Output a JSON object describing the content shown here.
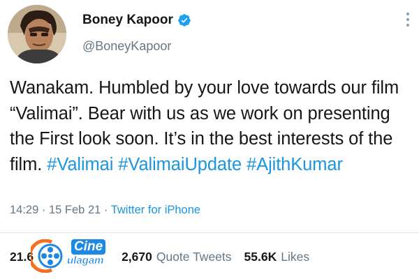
{
  "user": {
    "display_name": "Boney Kapoor",
    "handle": "@BoneyKapoor",
    "verified": true
  },
  "tweet": {
    "segments": [
      {
        "text": "Wanakam. Humbled by your love towards our film “Valimai”. Bear with us as we work on presenting the First look soon. It’s in the best interests of the film. ",
        "type": "text"
      },
      {
        "text": "#Valimai",
        "type": "hashtag"
      },
      {
        "text": " ",
        "type": "text"
      },
      {
        "text": "#ValimaiUpdate",
        "type": "hashtag"
      },
      {
        "text": " ",
        "type": "text"
      },
      {
        "text": "#AjithKumar",
        "type": "hashtag"
      }
    ],
    "time": "14:29",
    "date": "15 Feb 21",
    "separator": "·",
    "source": "Twitter for iPhone"
  },
  "stats": {
    "retweets_count": "21.6",
    "quote_tweets_count": "2,670",
    "quote_tweets_label": "Quote Tweets",
    "likes_count": "55.6K",
    "likes_label": "Likes"
  },
  "watermark": {
    "line1": "Cine",
    "line2": "ulagam"
  },
  "colors": {
    "link": "#1b95e0",
    "secondary_text": "#657786",
    "verified": "#1da1f2",
    "watermark": "#1e88e5"
  },
  "icons": {
    "verified": "verified-badge-icon",
    "more": "more-vertical-icon"
  }
}
